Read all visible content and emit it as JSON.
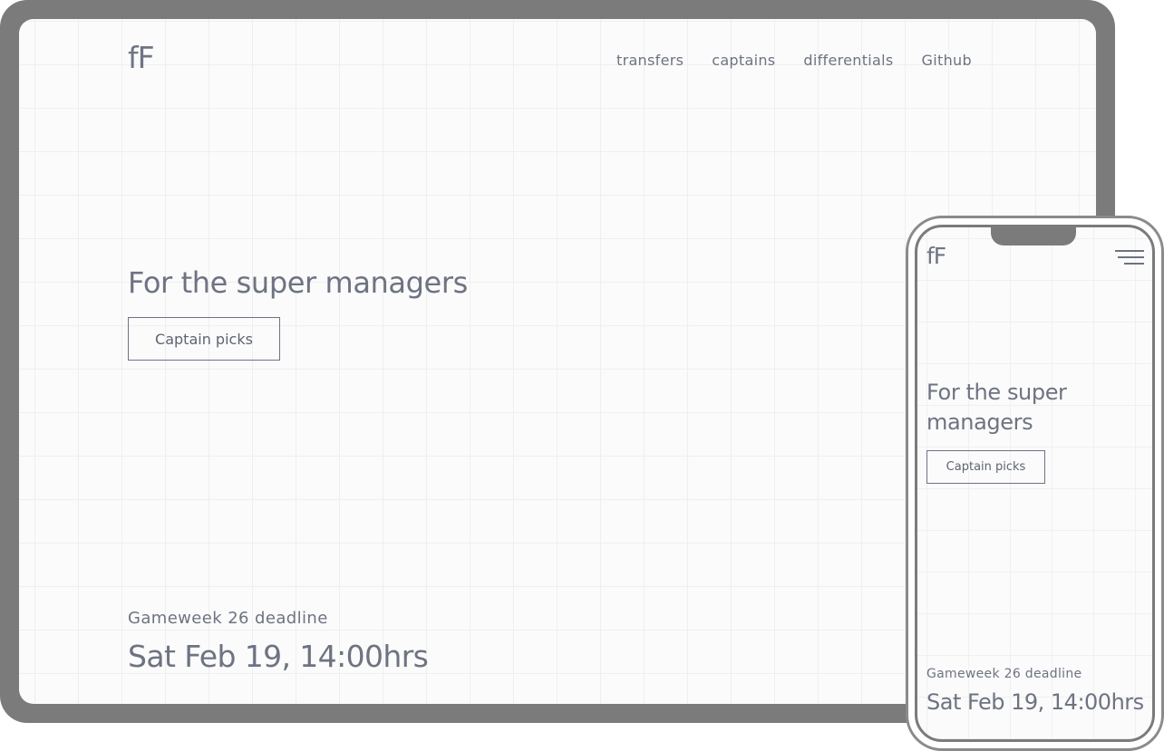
{
  "desktop": {
    "logo": "fF",
    "nav": [
      {
        "label": "transfers"
      },
      {
        "label": "captains"
      },
      {
        "label": "differentials"
      },
      {
        "label": "Github"
      }
    ],
    "hero": {
      "title": "For the super managers",
      "cta_label": "Captain picks"
    },
    "deadline": {
      "label": "Gameweek 26 deadline",
      "value": "Sat Feb 19, 14:00hrs"
    }
  },
  "mobile": {
    "logo": "fF",
    "menu_icon": "hamburger-menu-icon",
    "hero": {
      "title": "For the super managers",
      "cta_label": "Captain picks"
    },
    "deadline": {
      "label": "Gameweek 26 deadline",
      "value": "Sat Feb 19, 14:00hrs"
    }
  },
  "colors": {
    "text": "#6e7382",
    "frame": "#7b7b7b",
    "background": "#fbfbfb",
    "grid": "#efefef"
  }
}
